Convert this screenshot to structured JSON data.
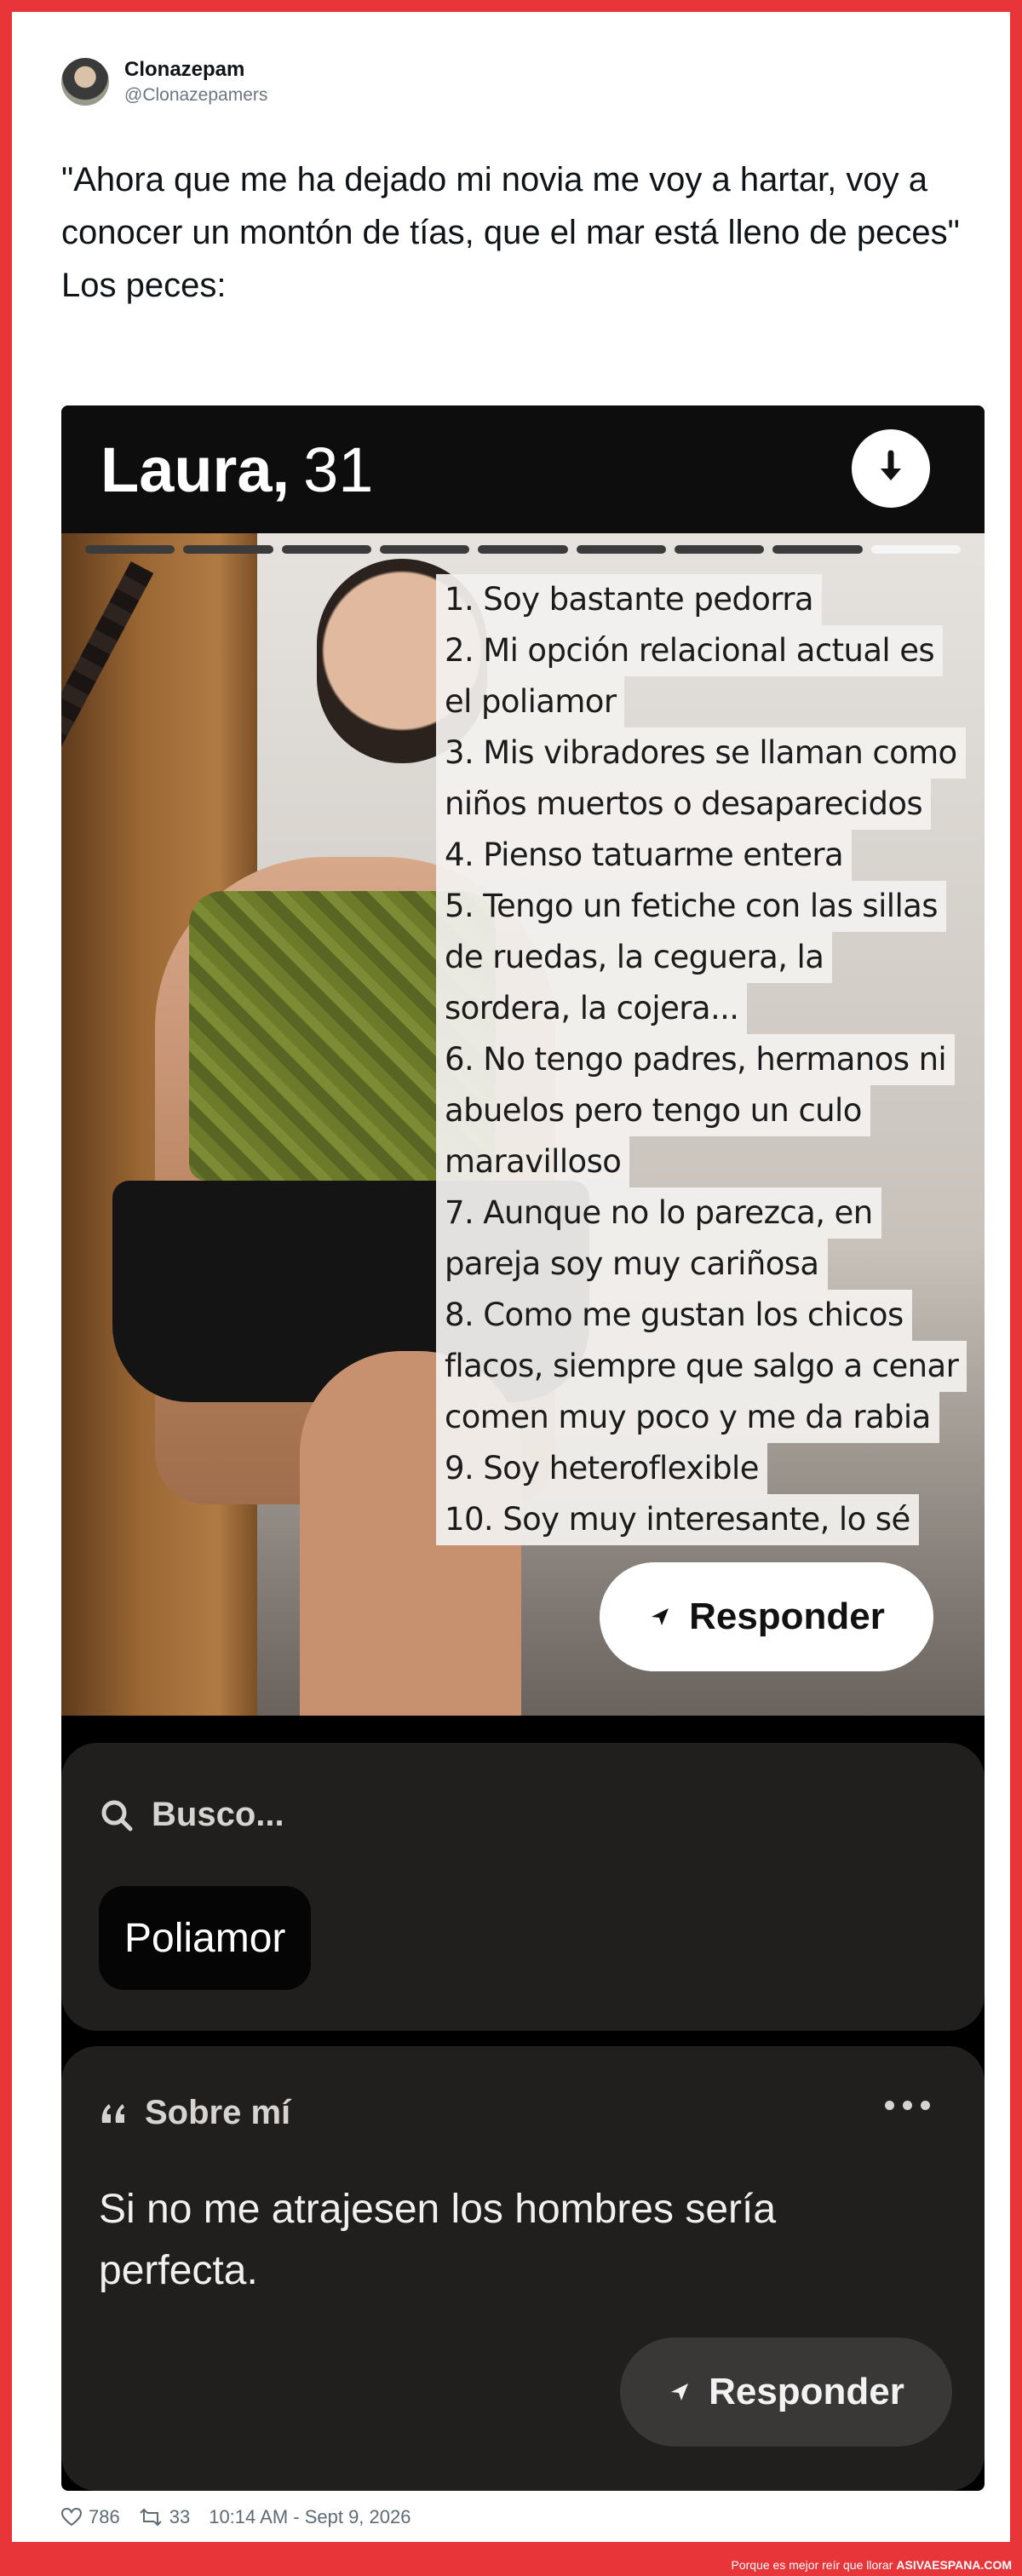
{
  "tweet": {
    "author_name": "Clonazepam",
    "author_handle": "@Clonazepamers",
    "text": "\"Ahora que me ha dejado mi novia me voy a hartar, voy a conocer un montón de tías, que el mar está lleno de peces\"\nLos peces:",
    "likes": "786",
    "retweets": "33",
    "timestamp": "10:14 AM - Sept 9, 2026"
  },
  "profile": {
    "name": "Laura,",
    "age": "31",
    "progress": {
      "segments": 9,
      "active_index": 8
    },
    "list": [
      "1. Soy bastante pedorra",
      "2. Mi opción relacional actual es",
      "el poliamor",
      "3. Mis vibradores se llaman como",
      "niños  muertos o desaparecidos",
      "4. Pienso tatuarme entera",
      "5. Tengo un fetiche con las sillas",
      "de ruedas, la ceguera, la",
      "sordera, la cojera...",
      "6. No tengo padres, hermanos ni",
      "abuelos pero tengo un culo",
      "maravilloso",
      "7. Aunque no lo parezca, en",
      "pareja soy muy cariñosa",
      "8. Como me gustan los chicos",
      "flacos, siempre que salgo a cenar",
      "comen muy poco y me da rabia",
      "9. Soy heteroflexible",
      "10. Soy muy interesante, lo sé"
    ],
    "reply_label": "Responder",
    "busco": {
      "heading": "Busco...",
      "chip": "Poliamor"
    },
    "about": {
      "heading": "Sobre mí",
      "text": "Si no me atrajesen los hombres sería perfecta.",
      "reply_label": "Responder"
    }
  },
  "footer": {
    "tagline": "Porque es mejor reír que llorar",
    "brand": "ASIVAESPANA.COM"
  },
  "colors": {
    "frame": "#e8353a",
    "card_bg": "#211f1e",
    "progress_active": "#f5f5f5"
  },
  "icons": [
    "down-arrow-icon",
    "send-icon",
    "search-icon",
    "quote-icon",
    "more-icon",
    "heart-icon",
    "retweet-icon"
  ]
}
